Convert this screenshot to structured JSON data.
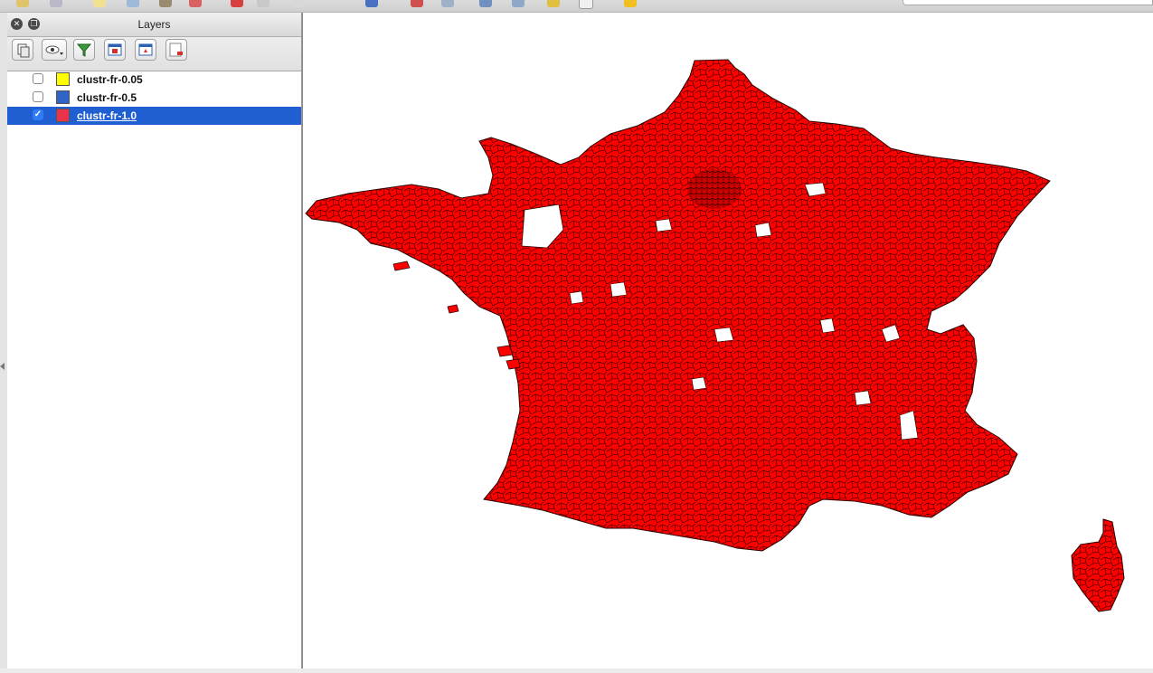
{
  "panel": {
    "title": "Layers",
    "close_icon": "close-icon",
    "float_icon": "undock-icon",
    "toolbar": [
      "add-group-icon",
      "visibility-eye-icon",
      "filter-legend-icon",
      "expand-all-icon",
      "collapse-all-icon",
      "remove-layer-icon"
    ]
  },
  "layers": [
    {
      "name": "clustr-fr-0.05",
      "checked": false,
      "color": "#ffff00",
      "selected": false
    },
    {
      "name": "clustr-fr-0.5",
      "checked": false,
      "color": "#2f64c6",
      "selected": false
    },
    {
      "name": "clustr-fr-1.0",
      "checked": true,
      "color": "#e8334a",
      "selected": true
    }
  ],
  "map": {
    "fill_color": "#ff0000",
    "stroke_color": "#2a0000",
    "background": "#ffffff"
  },
  "colors": {
    "selection": "#1f5fd1"
  }
}
